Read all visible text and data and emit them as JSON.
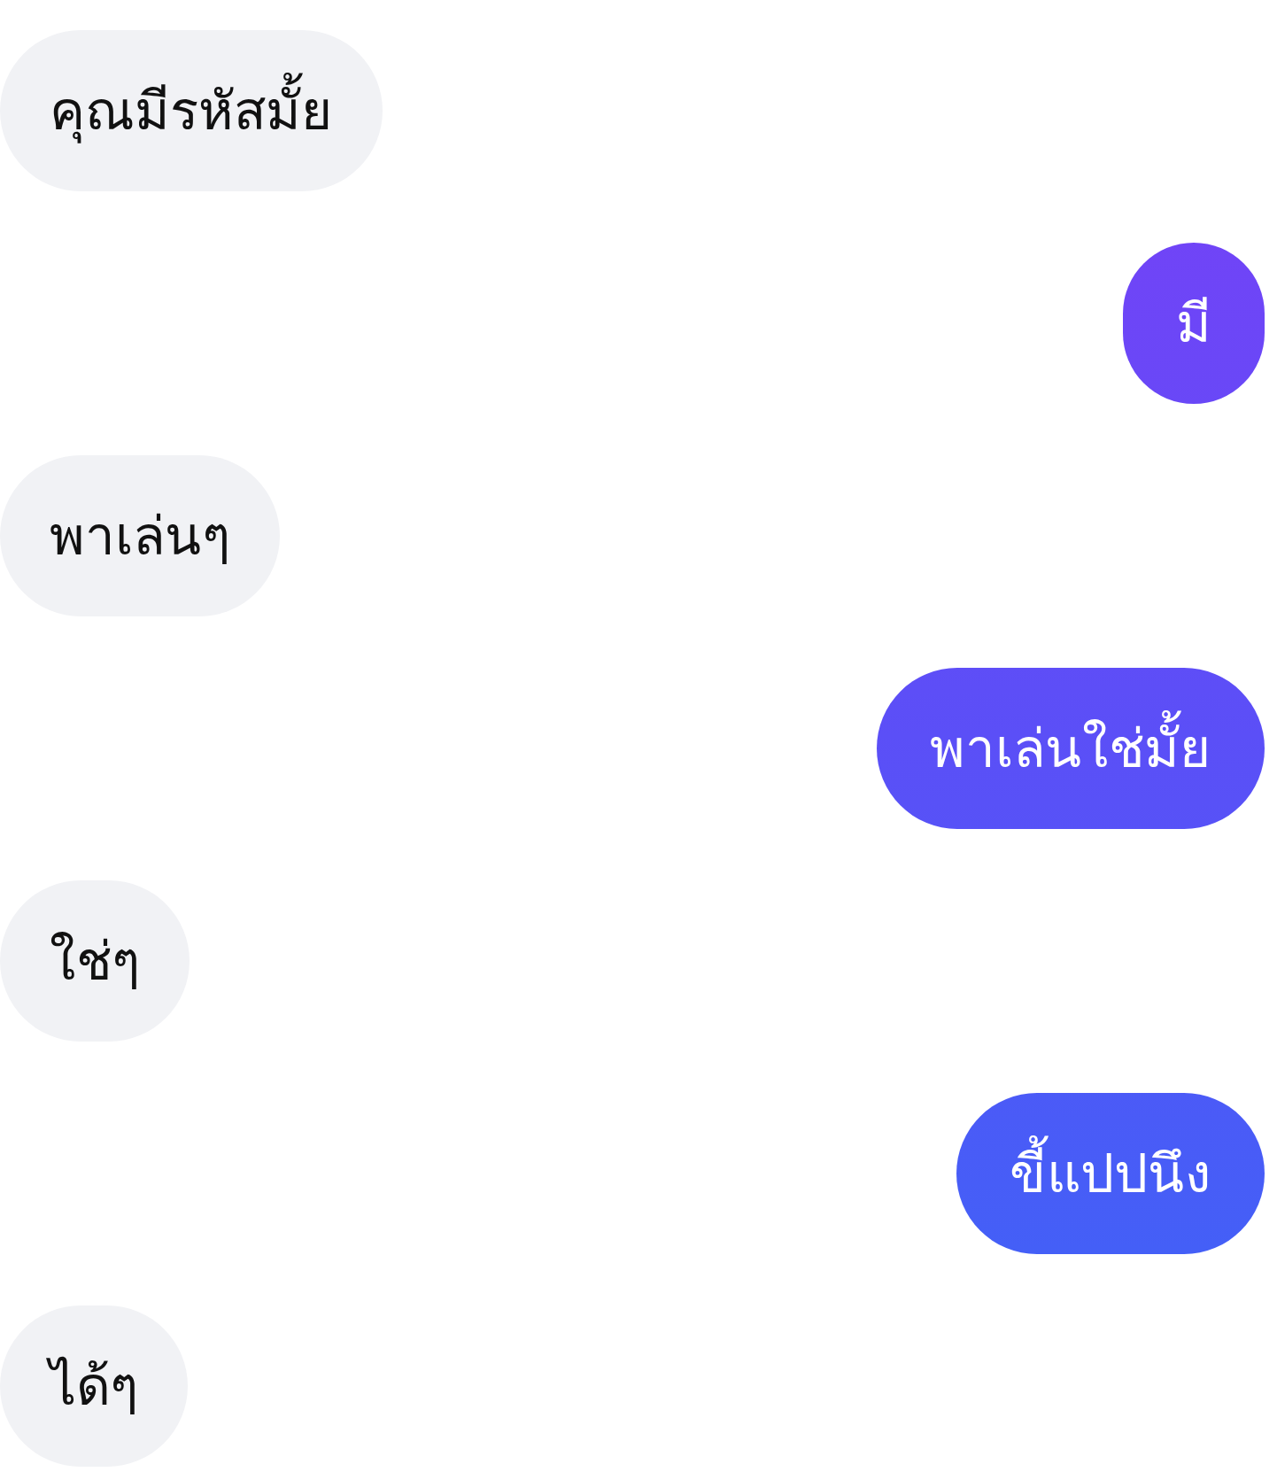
{
  "messages": [
    {
      "kind": "received",
      "text": "คุณมีรหัสมั้ย"
    },
    {
      "kind": "sent",
      "text": "มี"
    },
    {
      "kind": "received",
      "text": "พาเล่นๆ"
    },
    {
      "kind": "sent",
      "text": "พาเล่นใช่มั้ย"
    },
    {
      "kind": "received",
      "text": "ใช่ๆ"
    },
    {
      "kind": "sent",
      "text": "ขี้แปปนึง"
    },
    {
      "kind": "received",
      "text": "ได้ๆ"
    }
  ]
}
